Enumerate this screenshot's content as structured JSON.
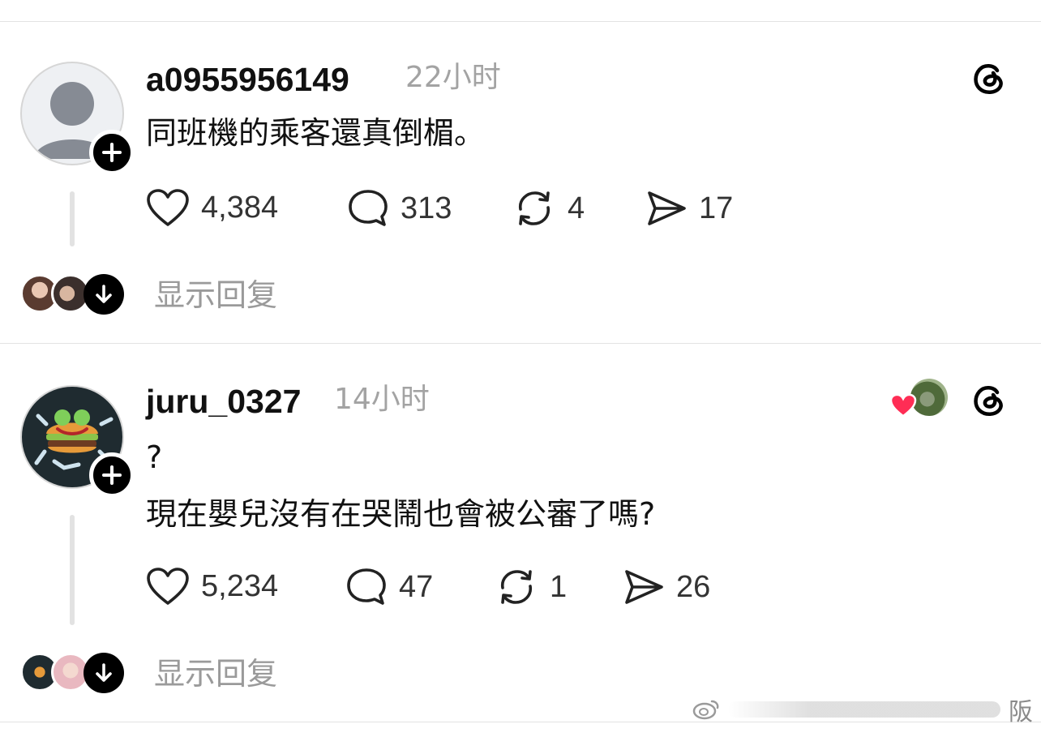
{
  "posts": [
    {
      "username": "a0955956149",
      "time": "22小时",
      "lines": [
        "同班機的乘客還真倒楣。"
      ],
      "likes": "4,384",
      "comments": "313",
      "reposts": "4",
      "shares": "17",
      "show_replies": "显示回复",
      "avatar": "default-user-avatar"
    },
    {
      "username": "juru_0327",
      "time": "14小时",
      "lines": [
        "?",
        "現在嬰兒沒有在哭鬧也會被公審了嗎?"
      ],
      "likes": "5,234",
      "comments": "47",
      "reposts": "1",
      "shares": "26",
      "show_replies": "显示回复",
      "avatar": "burger-avatar"
    }
  ],
  "watermark": {
    "text": "阪"
  },
  "colors": {
    "like_heart": "#ff2d55",
    "muted_text": "#9a9a9a",
    "divider": "#e3e3e3"
  }
}
